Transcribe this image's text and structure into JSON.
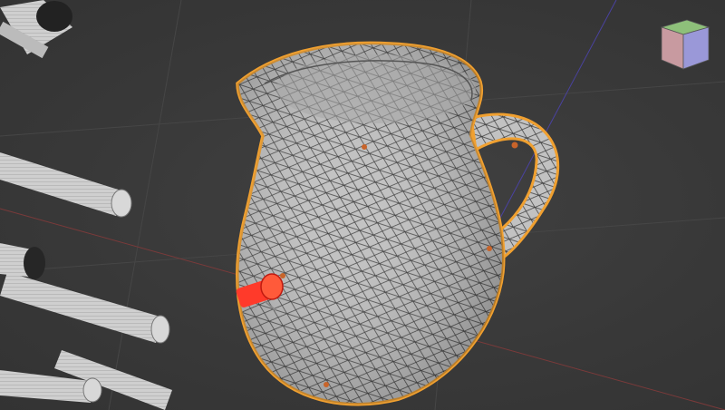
{
  "viewport": {
    "background": "#3a3a3a",
    "grid_color": "#4a4a4a",
    "x_axis_color": "#8a3a3a",
    "y_axis_color": "#5a4ab0"
  },
  "selected_object": {
    "name_icon": "jug-mesh",
    "outline_color": "#f0a030",
    "surface_color": "#bdbdbd",
    "wire_color": "#2a2a2a",
    "marker_color": "#c8642a"
  },
  "manipulator": {
    "icon": "gizmo-handle",
    "color": "#ff3a2a"
  },
  "nav_cube": {
    "icon": "view-cube",
    "top_color": "#8ec07a",
    "front_color": "#9a98d8",
    "side_color": "#c89aa0"
  },
  "background_objects": {
    "icon": "cylinder-mesh",
    "count": 6,
    "color": "#c8c8c8"
  }
}
